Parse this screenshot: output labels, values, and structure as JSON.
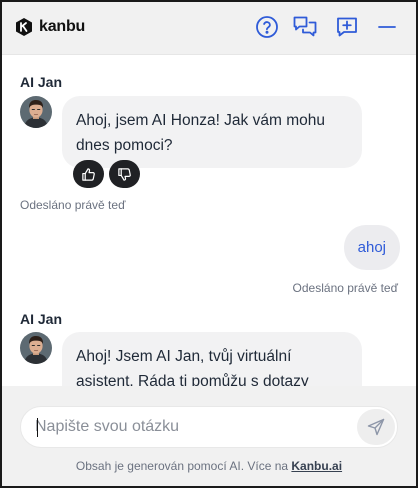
{
  "header": {
    "brand_name": "kanbu",
    "icons": [
      "help-circle-icon",
      "chats-icon",
      "new-chat-icon",
      "minimize-icon"
    ],
    "accent_color": "#2f5bd8"
  },
  "messages": [
    {
      "role": "assistant",
      "sender": "AI Jan",
      "text": "Ahoj, jsem AI Honza! Jak vám mohu dnes pomoci?",
      "status": "Odesláno právě teď"
    },
    {
      "role": "user",
      "text": "ahoj",
      "status": "Odesláno právě teď"
    },
    {
      "role": "assistant",
      "sender": "AI Jan",
      "text": "Ahoj! Jsem AI Jan, tvůj virtuální asistent. Ráda ti pomůžu s dotazy"
    }
  ],
  "composer": {
    "placeholder": "Napište svou otázku",
    "value": "",
    "footer_prefix": "Obsah je generován pomocí AI. Více na ",
    "footer_link": "Kanbu.ai"
  }
}
